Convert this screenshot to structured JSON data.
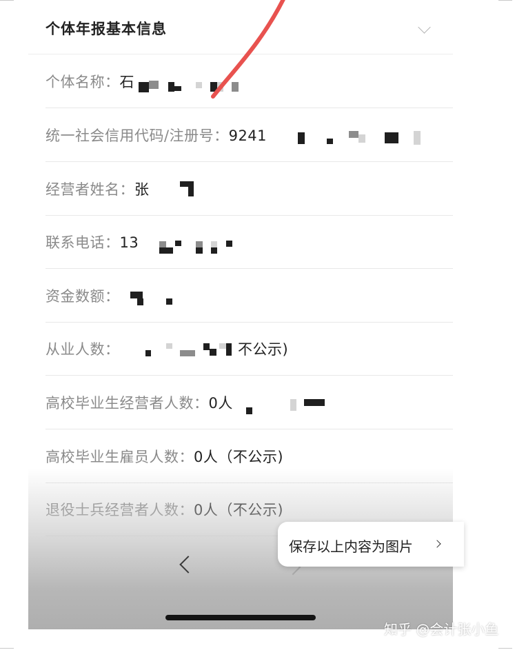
{
  "section": {
    "title": "个体年报基本信息"
  },
  "rows": [
    {
      "label": "个体名称：",
      "value": "石"
    },
    {
      "label": "统一社会信用代码/注册号：",
      "value": "9241"
    },
    {
      "label": "经营者姓名：",
      "value": "张"
    },
    {
      "label": "联系电话：",
      "value": "13"
    },
    {
      "label": "资金数额：",
      "value": ""
    },
    {
      "label": "从业人数：",
      "value": "不公示)"
    },
    {
      "label": "高校毕业生经营者人数：",
      "value": "0人"
    },
    {
      "label": "高校毕业生雇员人数：",
      "value": "0人（不公示)"
    },
    {
      "label": "退役士兵经营者人数：",
      "value": "0人（不公示)"
    }
  ],
  "save_button": {
    "label": "保存以上内容为图片"
  },
  "watermark": {
    "text": "知乎 @会计张小鱼"
  },
  "icons": {
    "collapse": "chevron-down-icon",
    "back": "chevron-left-icon",
    "forward": "chevron-right-icon",
    "save_arrow": "chevron-right-icon"
  },
  "colors": {
    "annotation_stroke": "#e8524f",
    "label": "#8a8a8a",
    "value": "#222222"
  }
}
